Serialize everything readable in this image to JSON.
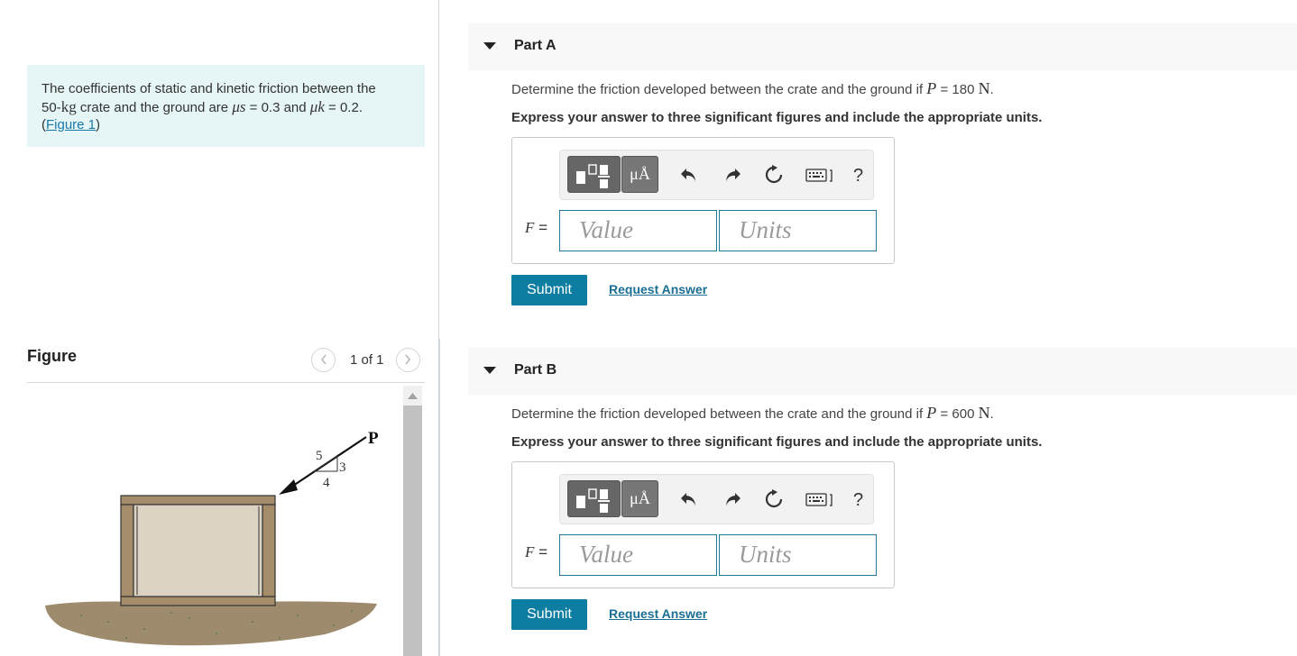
{
  "problem": {
    "text_1": "The coefficients of static and kinetic friction between the",
    "mass_value": "50-",
    "mass_unit": "kg",
    "text_2": " crate and the ground are ",
    "mu_s_symbol": "μs",
    "mu_s_value": " = 0.3 and ",
    "mu_k_symbol": "μk",
    "mu_k_value": " = 0.2.",
    "figure_link_open": "(",
    "figure_link": "Figure 1",
    "figure_link_close": ")"
  },
  "figure": {
    "title": "Figure",
    "counter": "1 of 1",
    "prev_icon": "chevron-left-icon",
    "next_icon": "chevron-right-icon",
    "labels": {
      "force": "P",
      "slope_5": "5",
      "slope_3": "3",
      "slope_4": "4"
    }
  },
  "parts": [
    {
      "title": "Part A",
      "question_prefix": "Determine the friction developed between the crate and the ground if ",
      "var": "P",
      "equals": " = 180 ",
      "unit": "N",
      "period": ".",
      "instruction": "Express your answer to three significant figures and include the appropriate units.",
      "eq_label": "F",
      "eq_sign": " =",
      "value_placeholder": "Value",
      "units_placeholder": "Units",
      "submit": "Submit",
      "request": "Request Answer"
    },
    {
      "title": "Part B",
      "question_prefix": "Determine the friction developed between the crate and the ground if ",
      "var": "P",
      "equals": " = 600 ",
      "unit": "N",
      "period": ".",
      "instruction": "Express your answer to three significant figures and include the appropriate units.",
      "eq_label": "F",
      "eq_sign": " =",
      "value_placeholder": "Value",
      "units_placeholder": "Units",
      "submit": "Submit",
      "request": "Request Answer"
    }
  ],
  "toolbar": {
    "templates_icon": "templates-icon",
    "units_symbol": "μÅ",
    "undo_icon": "undo-icon",
    "redo_icon": "redo-icon",
    "reset_icon": "reset-icon",
    "keyboard_icon": "keyboard-icon",
    "help": "?"
  },
  "colors": {
    "accent": "#0d7ea1",
    "link": "#1a78a8",
    "problem_bg": "#e6f5f6",
    "header_bg": "#f8f8f8"
  }
}
